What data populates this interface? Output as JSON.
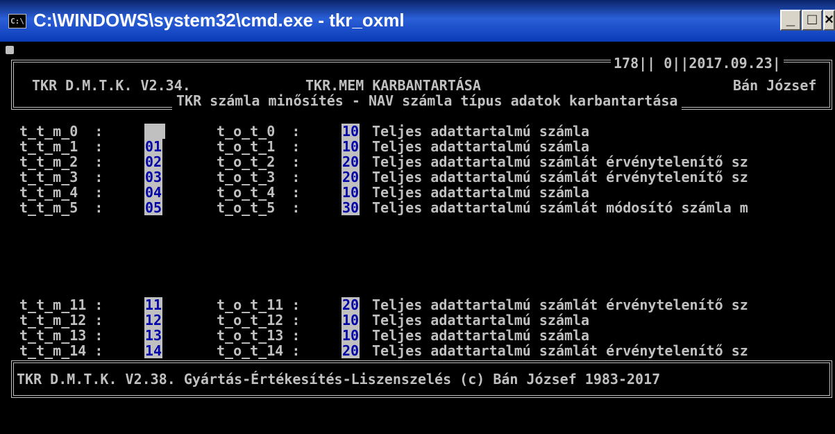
{
  "window": {
    "title": "C:\\WINDOWS\\system32\\cmd.exe - tkr_oxml",
    "buttons": {
      "minimize": "_",
      "maximize": "□",
      "close": "×"
    }
  },
  "header": {
    "counters": "178|| 0||2017.09.23|",
    "left": "TKR D.M.T.K. V2.34.",
    "center": "TKR.MEM KARBANTARTÁSA",
    "right": "Bán József",
    "subtitle": "TKR számla minősítés - NAV számla típus adatok karbantartása"
  },
  "rows_top": [
    {
      "m": "t_t_m_0  :",
      "mv": "",
      "o": "t_o_t_0  :",
      "ov": "10",
      "desc": "Teljes adattartalmú számla"
    },
    {
      "m": "t_t_m_1  :",
      "mv": "01",
      "o": "t_o_t_1  :",
      "ov": "10",
      "desc": "Teljes adattartalmú számla"
    },
    {
      "m": "t_t_m_2  :",
      "mv": "02",
      "o": "t_o_t_2  :",
      "ov": "20",
      "desc": "Teljes adattartalmú számlát érvénytelenítő sz"
    },
    {
      "m": "t_t_m_3  :",
      "mv": "03",
      "o": "t_o_t_3  :",
      "ov": "20",
      "desc": "Teljes adattartalmú számlát érvénytelenítő sz"
    },
    {
      "m": "t_t_m_4  :",
      "mv": "04",
      "o": "t_o_t_4  :",
      "ov": "10",
      "desc": "Teljes adattartalmú számla"
    },
    {
      "m": "t_t_m_5  :",
      "mv": "05",
      "o": "t_o_t_5  :",
      "ov": "30",
      "desc": "Teljes adattartalmú számlát módosító számla m"
    }
  ],
  "rows_bottom": [
    {
      "m": "t_t_m_11 :",
      "mv": "11",
      "o": "t_o_t_11 :",
      "ov": "20",
      "desc": "Teljes adattartalmú számlát érvénytelenítő sz"
    },
    {
      "m": "t_t_m_12 :",
      "mv": "12",
      "o": "t_o_t_12 :",
      "ov": "10",
      "desc": "Teljes adattartalmú számla"
    },
    {
      "m": "t_t_m_13 :",
      "mv": "13",
      "o": "t_o_t_13 :",
      "ov": "10",
      "desc": "Teljes adattartalmú számla"
    },
    {
      "m": "t_t_m_14 :",
      "mv": "14",
      "o": "t_o_t_14 :",
      "ov": "20",
      "desc": "Teljes adattartalmú számlát érvénytelenítő sz"
    }
  ],
  "footer": {
    "text": "TKR D.M.T.K. V2.38. Gyártás-Értékesítés-Liszenszelés (c) Bán József 1983-2017"
  }
}
